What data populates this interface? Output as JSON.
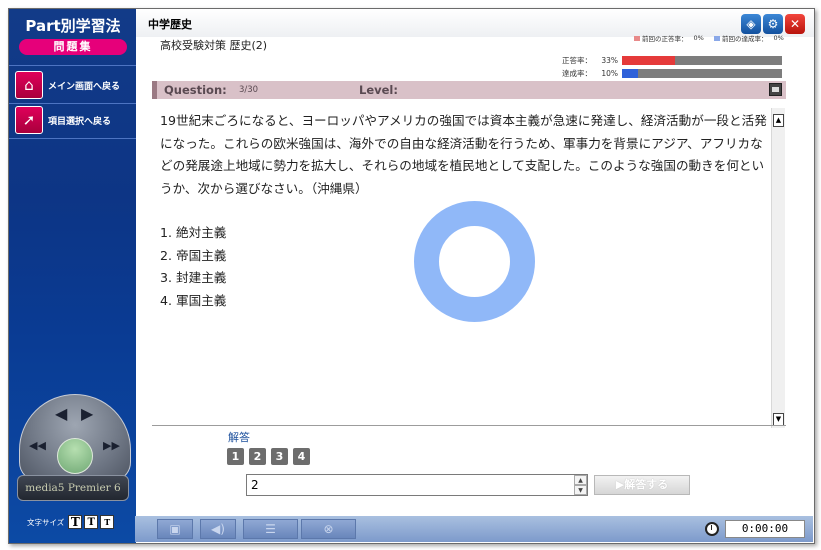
{
  "sidebar": {
    "logo_title": "Part別学習法",
    "logo_subtitle": "問題集",
    "items": [
      {
        "label": "メイン画面へ戻る",
        "icon": "home-icon"
      },
      {
        "label": "項目選択へ戻る",
        "icon": "pointer-icon"
      }
    ],
    "brand": "media5 Premier 6",
    "font_size_label": "文字サイズ",
    "font_size_buttons": [
      "T",
      "T",
      "T"
    ]
  },
  "header": {
    "title": "中学歴史",
    "icons": [
      "cube-icon",
      "gear-icon",
      "close-icon"
    ]
  },
  "subtitle": "高校受験対策 歴史(2)",
  "stats": {
    "legend_prev_correct": "前回の正答率：",
    "legend_prev_correct_value": "0%",
    "legend_prev_achieve": "前回の達成率：",
    "legend_prev_achieve_value": "0%",
    "correct_label": "正答率：",
    "correct_value": "33%",
    "correct_fraction": 0.33,
    "achieve_label": "達成率：",
    "achieve_value": "10%",
    "achieve_fraction": 0.1,
    "colors": {
      "correct": "#e53a3a",
      "achieve": "#2f61d9",
      "prev_correct": "#e88a8a",
      "prev_achieve": "#8aa8e8"
    }
  },
  "question_header": {
    "question_label": "Question:",
    "question_number": "3/30",
    "level_label": "Level:"
  },
  "question_text": "19世紀末ごろになると、ヨーロッパやアメリカの強国では資本主義が急速に発達し、経済活動が一段と活発になった。これらの欧米強国は、海外での自由な経済活動を行うため、軍事力を背景にアジア、アフリカなどの発展途上地域に勢力を拡大し、それらの地域を植民地として支配した。このような強国の動きを何というか、次から選びなさい。（沖縄県）",
  "choices": [
    "1.  絶対主義",
    "2.  帝国主義",
    "3.  封建主義",
    "4.  軍国主義"
  ],
  "answer": {
    "label": "解答",
    "buttons": [
      "1",
      "2",
      "3",
      "4"
    ],
    "input_value": "2",
    "submit_label": "▶解答する"
  },
  "toolbar": {
    "timer": "0:00:00"
  }
}
